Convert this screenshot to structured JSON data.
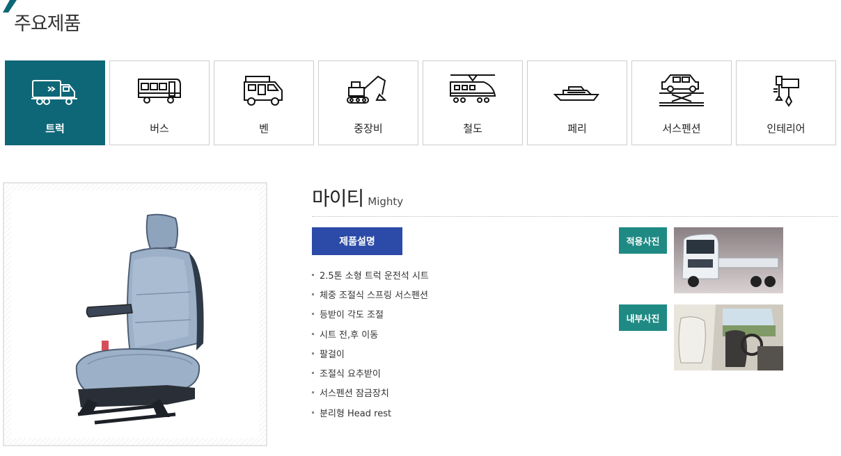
{
  "section": {
    "title": "주요제품"
  },
  "tabs": [
    {
      "label": "트럭",
      "icon": "truck-icon",
      "active": true
    },
    {
      "label": "버스",
      "icon": "bus-icon",
      "active": false
    },
    {
      "label": "벤",
      "icon": "camper-van-icon",
      "active": false
    },
    {
      "label": "중장비",
      "icon": "excavator-icon",
      "active": false
    },
    {
      "label": "철도",
      "icon": "train-icon",
      "active": false
    },
    {
      "label": "페리",
      "icon": "ferry-icon",
      "active": false
    },
    {
      "label": "서스펜션",
      "icon": "suspension-icon",
      "active": false
    },
    {
      "label": "인테리어",
      "icon": "interior-tools-icon",
      "active": false
    }
  ],
  "product": {
    "name_ko": "마이티",
    "name_en": "Mighty",
    "image": "seat-image",
    "description_button": "제품설명",
    "features": [
      "2.5톤 소형 트럭 운전석 시트",
      "체중 조절식 스프링 서스펜션",
      "등받이 각도 조절",
      "시트 전,후 이동",
      "팔걸이",
      "조절식 요추받이",
      "서스펜션 잠금장치",
      "분리형 Head rest"
    ],
    "photos": {
      "applied_label": "적용사진",
      "interior_label": "내부사진"
    }
  },
  "colors": {
    "active_tab": "#0e6776",
    "description_button": "#2c4ba8",
    "photo_label": "#1f8a84"
  }
}
